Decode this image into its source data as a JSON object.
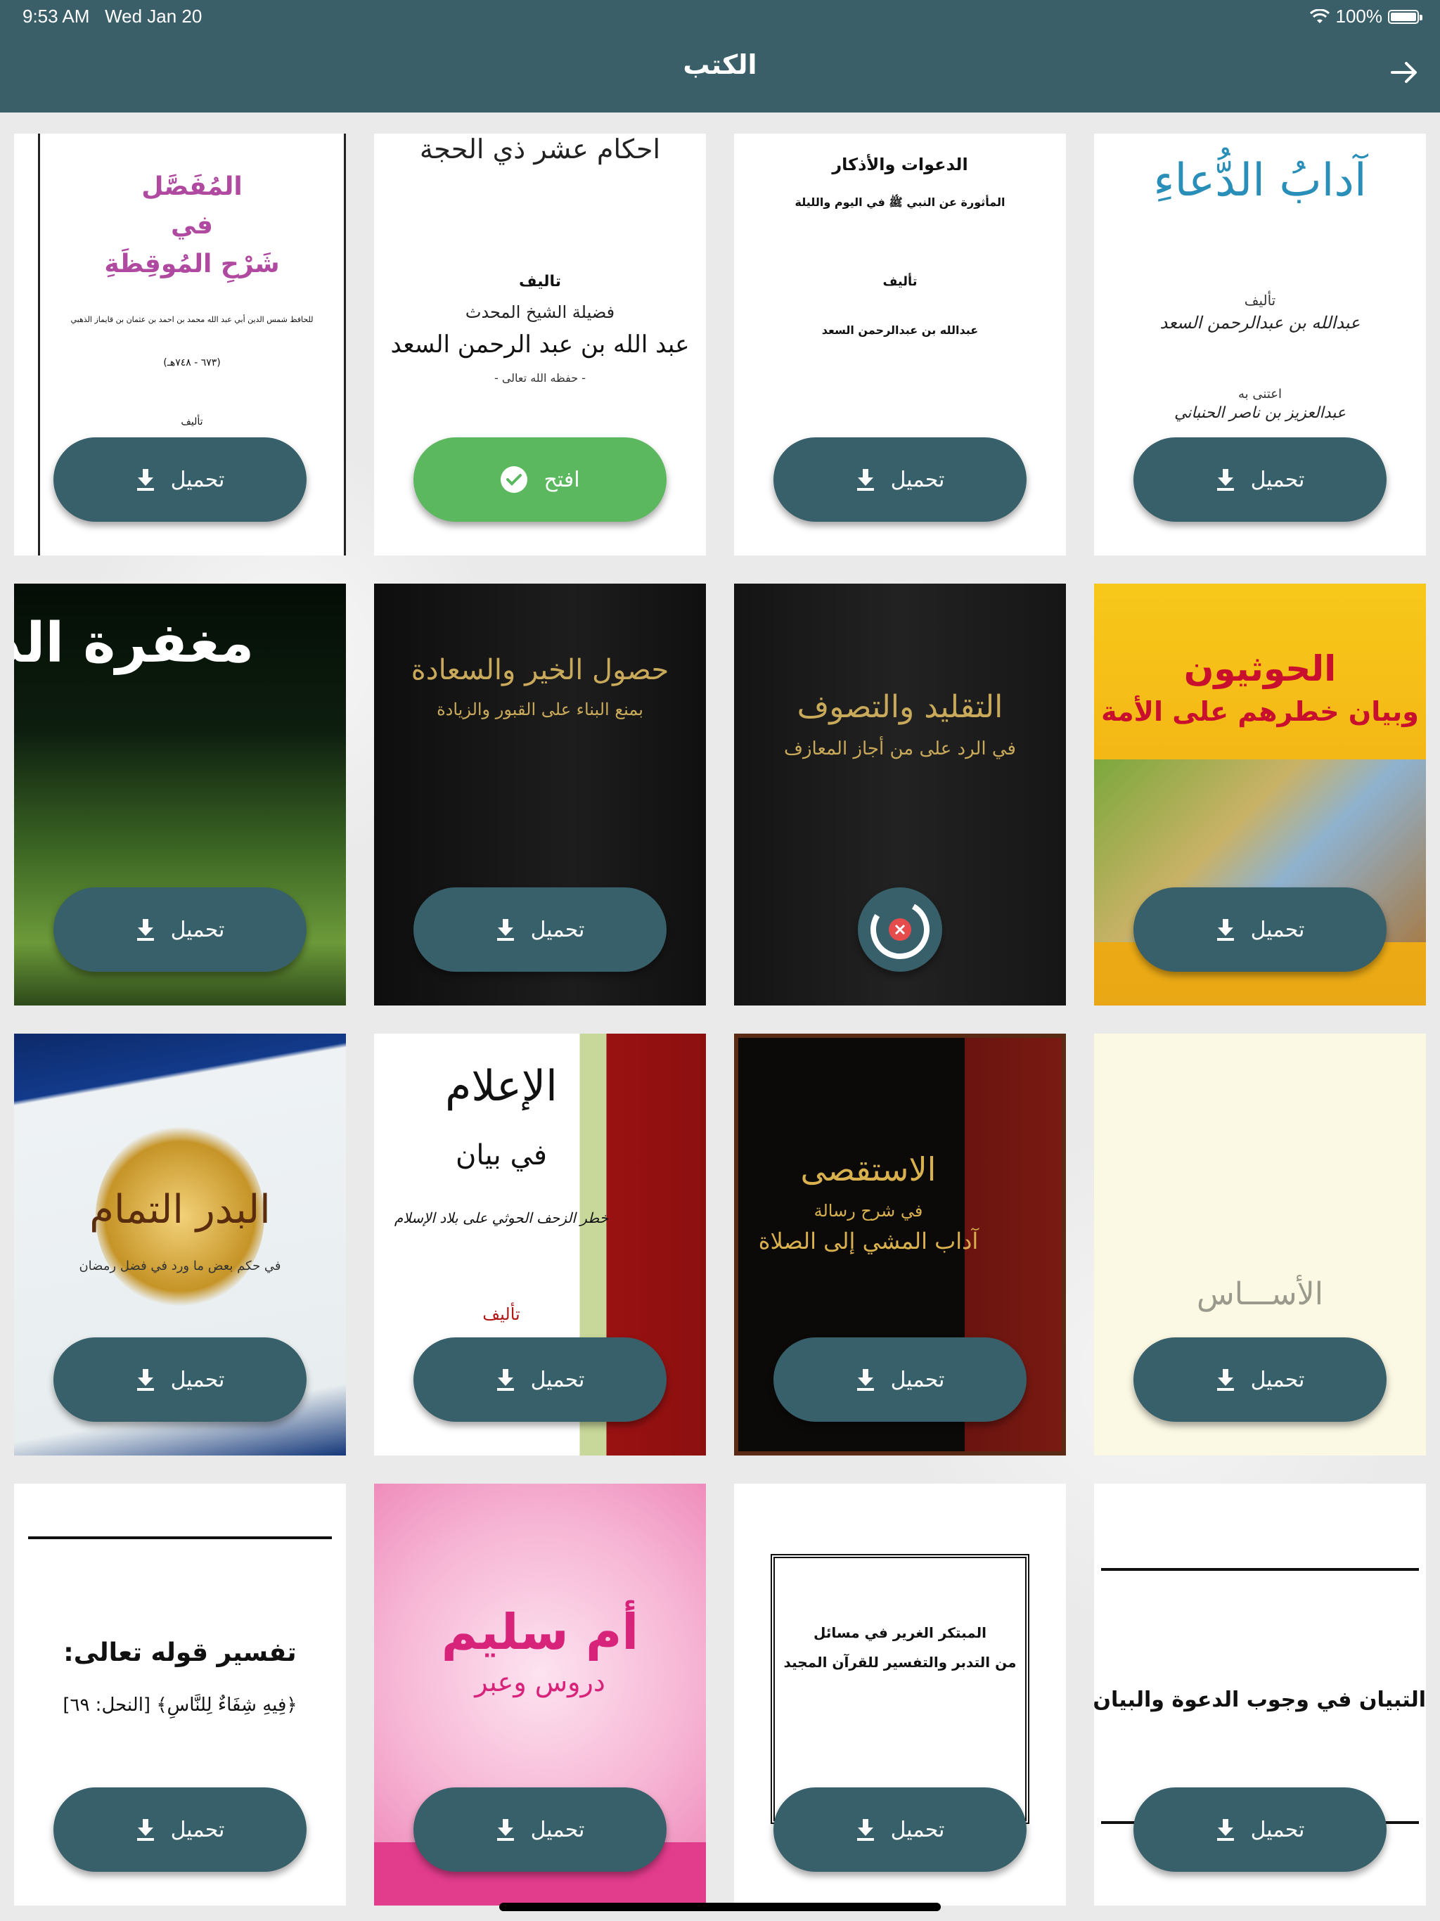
{
  "status_bar": {
    "time": "9:53 AM",
    "date": "Wed Jan 20",
    "battery": "100%"
  },
  "header": {
    "title": "الكتب"
  },
  "labels": {
    "download": "تحميل",
    "open": "افتح"
  },
  "books": [
    {
      "title_lines": [
        "آدابُ الدُّعاءِ"
      ],
      "author_label": "تأليف",
      "author": "عبدالله بن عبدالرحمن السعد",
      "extra": "اعتنى به",
      "extra2": "عبدالعزيز بن ناصر الحنباني",
      "action": "download"
    },
    {
      "title_lines": [
        "الدعوات والأذكار",
        "المأثورة عن النبي ﷺ في اليوم والليلة"
      ],
      "author_label": "تأليف",
      "author": "عبدالله بن عبدالرحمن السعد",
      "action": "download"
    },
    {
      "title_lines": [
        "احكام عشر ذي الحجة"
      ],
      "author_label": "تاليف",
      "author_intro": "فضيلة الشيخ المحدث",
      "author": "عبد الله بن عبد الرحمن السعد",
      "extra": "- حفظه الله تعالى -",
      "action": "open"
    },
    {
      "title_lines": [
        "المُفَصَّل",
        "في",
        "شَرْحِ المُوقِظَةِ"
      ],
      "subtitle": "للحافظ شمس الدين أبي عبد الله محمد بن احمد بن عثمان بن قايماز الذهبي",
      "extra": "(٦٧٣ - ٧٤٨هـ)",
      "author_label": "تأليف",
      "action": "download"
    },
    {
      "title_lines": [
        "الحوثيون",
        "وبيان خطرهم على الأمة"
      ],
      "action": "download"
    },
    {
      "title_lines": [
        "التقليد والتصوف",
        "في الرد على من أجاز المعازف"
      ],
      "action": "progress"
    },
    {
      "title_lines": [
        "حصول الخير والسعادة",
        "بمنع البناء على القبور والزيادة"
      ],
      "action": "download"
    },
    {
      "title_lines": [
        "مغفرة الذ"
      ],
      "action": "download"
    },
    {
      "title_lines": [
        "الأســـاس"
      ],
      "action": "download"
    },
    {
      "title_lines": [
        "الاستقصى",
        "في شرح رسالة",
        "آداب المشي إلى الصلاة"
      ],
      "action": "download"
    },
    {
      "title_lines": [
        "الإعلام",
        "في بيان",
        "خطر الزحف الحوثي على بلاد الإسلام"
      ],
      "author_label": "تأليف",
      "action": "download"
    },
    {
      "title_lines": [
        "البدر التمام",
        "في حكم بعض ما ورد في فضل رمضان"
      ],
      "action": "download"
    },
    {
      "title_lines": [
        "التبيان في وجوب الدعوة والبيان"
      ],
      "action": "download"
    },
    {
      "title_lines": [
        "المبتكر الغرير في مسائل",
        "من التدبر والتفسير للقرآن المجيد"
      ],
      "action": "download"
    },
    {
      "title_lines": [
        "أم سليم",
        "دروس وعبر"
      ],
      "action": "download"
    },
    {
      "title_lines": [
        "تفسير قوله تعالى:",
        "﴿فِيهِ شِفَاءٌ لِلنَّاسِ﴾ [النحل: ٦٩]"
      ],
      "action": "download"
    }
  ]
}
